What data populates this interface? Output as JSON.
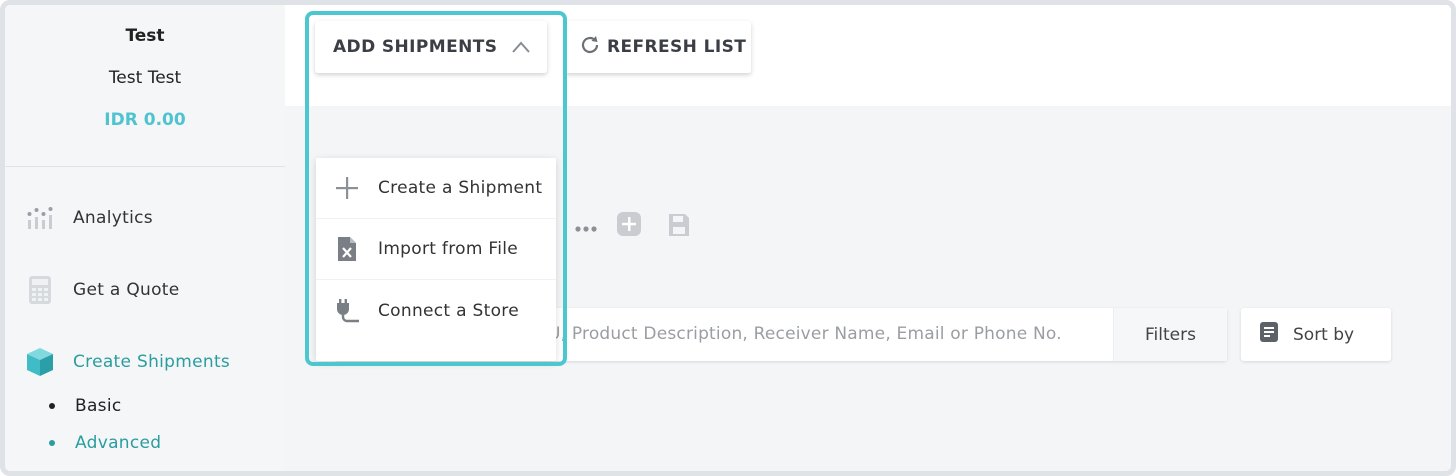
{
  "profile": {
    "name": "Test",
    "full_name": "Test Test",
    "balance": "IDR 0.00"
  },
  "sidebar": {
    "items": [
      {
        "label": "Analytics",
        "icon": "analytics-icon"
      },
      {
        "label": "Get a Quote",
        "icon": "calculator-icon"
      },
      {
        "label": "Create Shipments",
        "icon": "box-icon",
        "active": true
      }
    ],
    "sub_items": [
      {
        "label": "Basic"
      },
      {
        "label": "Advanced",
        "active": true
      }
    ]
  },
  "toolbar": {
    "add_shipments_label": "ADD SHIPMENTS",
    "refresh_label": "REFRESH LIST"
  },
  "dropdown": {
    "items": [
      {
        "label": "Create a Shipment",
        "icon": "plus-icon"
      },
      {
        "label": "Import from File",
        "icon": "excel-file-icon"
      },
      {
        "label": "Connect a Store",
        "icon": "plug-icon"
      }
    ]
  },
  "search": {
    "placeholder": "U, Product Description, Receiver Name, Email or Phone No.",
    "filters_label": "Filters",
    "sort_label": "Sort by"
  },
  "colors": {
    "accent": "#4fc3cf",
    "active_text": "#2a9d9f",
    "highlight": "#4cc7d0"
  }
}
